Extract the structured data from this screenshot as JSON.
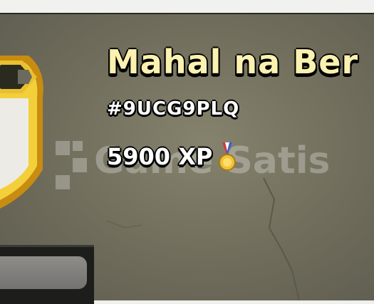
{
  "clan": {
    "name": "Mahal na Ber",
    "tag": "#9UCG9PLQ",
    "xp_label": "5900 XP"
  },
  "icons": {
    "badge": "clan-badge-shield-icon",
    "medal": "xp-medal-icon"
  },
  "watermark": {
    "text": "Game Satis"
  },
  "colors": {
    "panel_background": "#767361",
    "clan_name": "#fbf1b0",
    "badge_gold": "#e8b51a",
    "medal_ribbon_blue": "#3b5fd0",
    "medal_ribbon_red": "#d8343a"
  }
}
